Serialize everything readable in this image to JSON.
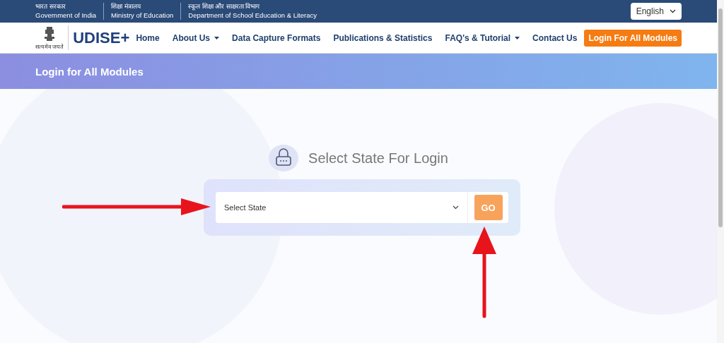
{
  "top_bar": {
    "departments": [
      {
        "hindi": "भारत सरकार",
        "english": "Government of India"
      },
      {
        "hindi": "शिक्षा मंत्रालय",
        "english": "Ministry of Education"
      },
      {
        "hindi": "स्कूल शिक्षा और साक्षरता विभाग",
        "english": "Department of School Education & Literacy"
      }
    ],
    "language": "English"
  },
  "header": {
    "motto": "सत्यमेव जयते",
    "logo_text": "UDISE+",
    "nav": [
      {
        "label": "Home",
        "dropdown": false
      },
      {
        "label": "About Us",
        "dropdown": true
      },
      {
        "label": "Data Capture Formats",
        "dropdown": false
      },
      {
        "label": "Publications & Statistics",
        "dropdown": false
      },
      {
        "label": "FAQ's & Tutorial",
        "dropdown": true
      },
      {
        "label": "Contact Us",
        "dropdown": false
      }
    ],
    "login_button": "Login For All Modules"
  },
  "banner": {
    "title": "Login for All Modules"
  },
  "login": {
    "heading": "Select State For Login",
    "select": {
      "placeholder": "Select State"
    },
    "go_button": "GO"
  }
}
